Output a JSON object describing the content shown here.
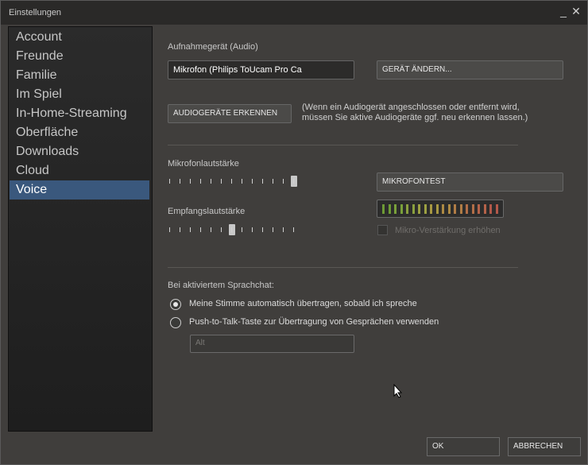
{
  "window": {
    "title": "Einstellungen"
  },
  "sidebar": {
    "items": [
      {
        "label": "Account"
      },
      {
        "label": "Freunde"
      },
      {
        "label": "Familie"
      },
      {
        "label": "Im Spiel"
      },
      {
        "label": "In-Home-Streaming"
      },
      {
        "label": "Oberfläche"
      },
      {
        "label": "Downloads"
      },
      {
        "label": "Cloud"
      },
      {
        "label": "Voice",
        "active": true
      }
    ]
  },
  "voice": {
    "recording_device_label": "Aufnahmegerät (Audio)",
    "recording_device_value": "Mikrofon (Philips ToUcam Pro Ca",
    "change_device_button": "GERÄT ÄNDERN...",
    "detect_devices_button": "AUDIOGERÄTE ERKENNEN",
    "detect_hint": "(Wenn ein Audiogerät angeschlossen oder entfernt wird,\nmüssen Sie aktive Audiogeräte ggf. neu erkennen lassen.)",
    "mic_volume_label": "Mikrofonlautstärke",
    "mic_volume_level": 1.0,
    "mic_test_button": "MIKROFONTEST",
    "receive_volume_label": "Empfangslautstärke",
    "receive_volume_level": 0.5,
    "boost_label": "Mikro-Verstärkung erhöhen",
    "boost_checked": false,
    "meter_colors": [
      "#6d9a35",
      "#79a03a",
      "#8aa03e",
      "#9ca042",
      "#a89842",
      "#ad8a43",
      "#b07c45",
      "#b26e47",
      "#b46249",
      "#b3584a"
    ],
    "voicechat_label": "Bei aktiviertem Sprachchat:",
    "option_auto": "Meine Stimme automatisch übertragen, sobald ich spreche",
    "option_ptt": "Push-to-Talk-Taste zur Übertragung von Gesprächen verwenden",
    "selected_option": "auto",
    "ptt_key": "Alt"
  },
  "footer": {
    "ok": "OK",
    "cancel": "ABBRECHEN"
  }
}
